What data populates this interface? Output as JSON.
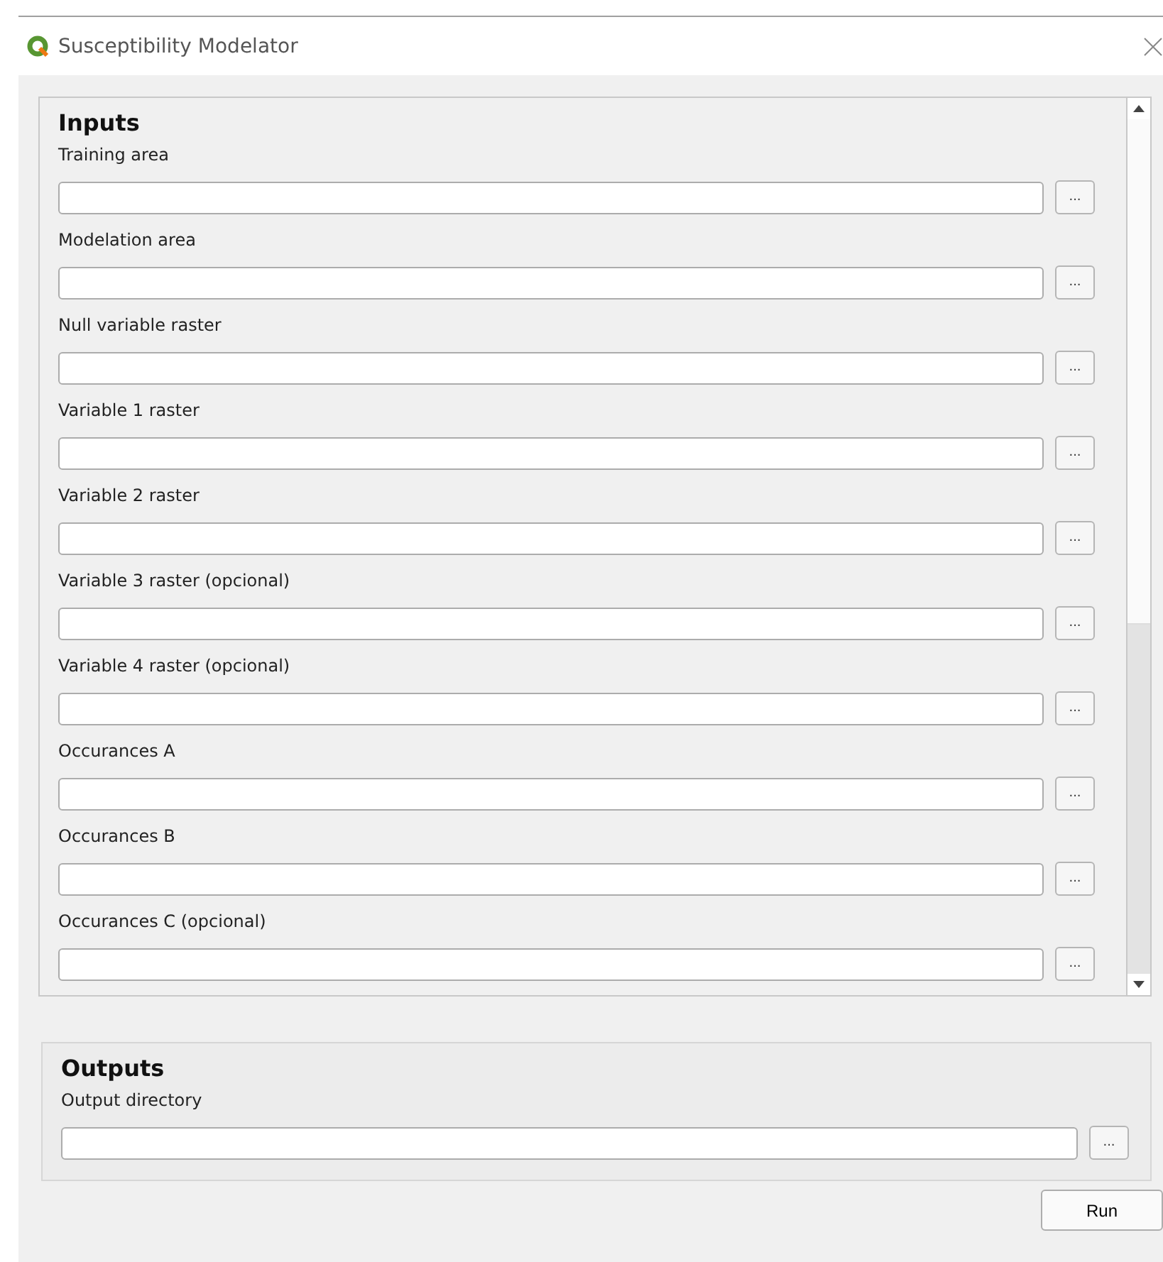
{
  "window": {
    "title": "Susceptibility Modelator"
  },
  "inputs": {
    "heading": "Inputs",
    "fields": [
      {
        "label": "Training area",
        "button": "..."
      },
      {
        "label": "Modelation area",
        "button": "..."
      },
      {
        "label": "Null variable raster",
        "button": "..."
      },
      {
        "label": "Variable 1 raster",
        "button": "..."
      },
      {
        "label": "Variable 2 raster",
        "button": "..."
      },
      {
        "label": "Variable 3 raster (opcional)",
        "button": "..."
      },
      {
        "label": "Variable 4 raster (opcional)",
        "button": "..."
      },
      {
        "label": "Occurances A",
        "button": "..."
      },
      {
        "label": "Occurances B",
        "button": "..."
      },
      {
        "label": "Occurances C (opcional)",
        "button": "..."
      }
    ]
  },
  "outputs": {
    "heading": "Outputs",
    "fields": [
      {
        "label": "Output directory",
        "button": "..."
      }
    ]
  },
  "buttons": [
    "Run"
  ]
}
